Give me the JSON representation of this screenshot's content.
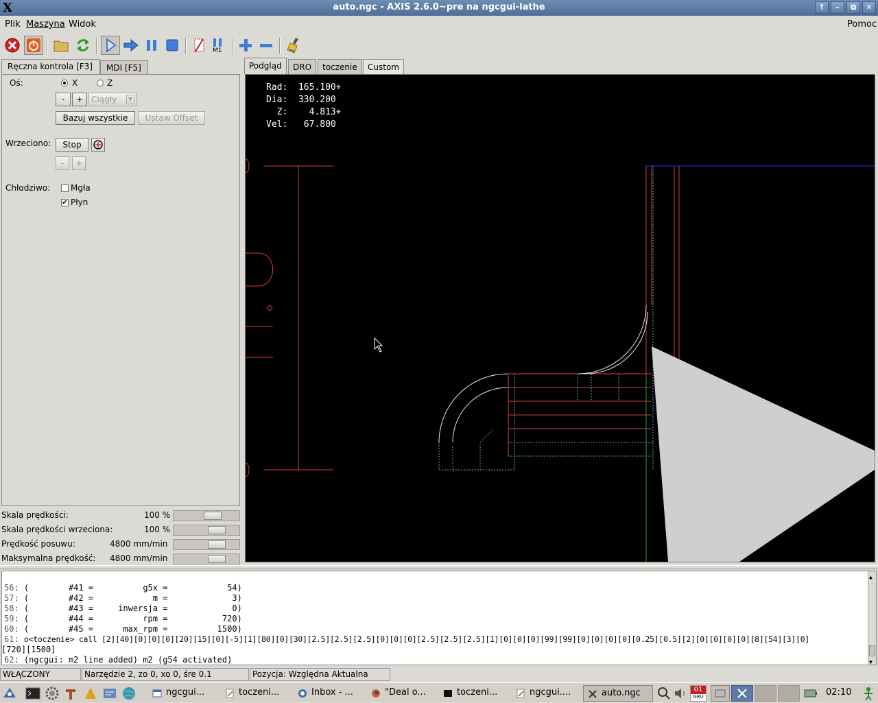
{
  "window": {
    "title": "auto.ngc - AXIS 2.6.0~pre na ngcgui-lathe",
    "x_logo": "X",
    "btn_up": "↑",
    "btn_min": "–",
    "btn_max": "⧉",
    "btn_close": "✕"
  },
  "menu": {
    "items": [
      "Plik",
      "Maszyna",
      "Widok"
    ],
    "help": "Pomoc"
  },
  "toolbar": {
    "icons": [
      "estop-icon",
      "machine-power-icon",
      "open-file-icon",
      "reload-icon",
      "run-icon",
      "step-icon",
      "pause-icon",
      "stop-icon",
      "block-delete-icon",
      "optional-stop-icon",
      "zoom-in-icon",
      "zoom-out-icon",
      "clear-plot-icon"
    ]
  },
  "left_tabs": [
    "Ręczna kontrola [F3]",
    "MDI [F5]"
  ],
  "manual": {
    "axis_label": "Oś:",
    "axis_x": "X",
    "axis_z": "Z",
    "jog_minus": "-",
    "jog_plus": "+",
    "jog_mode": "Ciągły",
    "home_all": "Bazuj wszystkie",
    "set_offset": "Ustaw Offset",
    "spindle_label": "Wrzeciono:",
    "spindle_stop": "Stop",
    "spindle_minus": "-",
    "spindle_plus": "+",
    "coolant_label": "Chłodziwo:",
    "mist": "Mgła",
    "flood": "Płyn",
    "flood_checked": true,
    "mist_checked": false,
    "checkmark": "✔"
  },
  "scales": [
    {
      "label": "Skala prędkości:",
      "value": "100 %",
      "level": 0.63
    },
    {
      "label": "Skala prędkości wrzeciona:",
      "value": "100 %",
      "level": 0.72
    },
    {
      "label": "Prędkość posuwu:",
      "value": "4800 mm/min",
      "level": 0.72
    },
    {
      "label": "Maksymalna prędkość:",
      "value": "4800 mm/min",
      "level": 0.72
    }
  ],
  "right_tabs": [
    "Podgląd",
    "DRO",
    "toczenie",
    "Custom"
  ],
  "dro": {
    "rad_label": "Rad:",
    "rad": "165.100",
    "dia_label": "Dia:",
    "dia": "330.200",
    "z_label": "Z:",
    "z": "4.813",
    "vel_label": "Vel:",
    "vel": "67.800"
  },
  "log": [
    {
      "n": "56:",
      "text": "(        #41 =          g5x =            54)"
    },
    {
      "n": "57:",
      "text": "(        #42 =            m =             3)"
    },
    {
      "n": "58:",
      "text": "(        #43 =     inwersja =             0)"
    },
    {
      "n": "59:",
      "text": "(        #44 =          rpm =           720)"
    },
    {
      "n": "60:",
      "text": "(        #45 =      max_rpm =          1500)"
    },
    {
      "n": "61:",
      "text": "o<toczenie> call [2][40][0][0][0][20][15][0][-5][1][80][0][30][2.5][2.5][2.5][0][0][0][2.5][2.5][2.5][1][0][0][0][99][99][0][0][0][0][0.25][0.5][2][0][0][0][0][8][54][3][0]"
    },
    {
      "n": "",
      "text": "[720][1500]"
    },
    {
      "n": "62:",
      "text": "(ngcgui: m2 line added) m2 (g54 activated)"
    }
  ],
  "status": {
    "state": "WŁĄCZONY",
    "tool": "Narzędzie 2, zo 0, xo 0, śre 0.1",
    "position": "Pozycja: Względna Aktualna"
  },
  "taskbar": {
    "tasks": [
      "ngcgui...",
      "toczeni...",
      "Inbox - ...",
      "\"Deal o...",
      "toczeni...",
      "ngcgui....",
      "auto.ngc"
    ],
    "date_day": "01",
    "date_month": "GRU",
    "clock": "02:10"
  }
}
